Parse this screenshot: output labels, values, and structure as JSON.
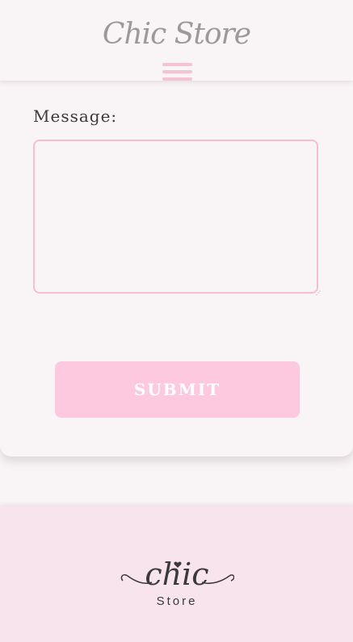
{
  "header": {
    "brand": "Chic Store",
    "menu_icon": "hamburger-menu-icon"
  },
  "form": {
    "message_label": "Message:",
    "message_value": "",
    "submit_label": "SUBMIT"
  },
  "footer": {
    "logo_word": "chic",
    "logo_sub": "Store"
  },
  "colors": {
    "background": "#f9f4f5",
    "accent_pink": "#f6c2d6",
    "button_pink": "#fcc9de",
    "footer_pink": "#f8e4ec",
    "text_dark": "#3a3a3a",
    "brand_gray": "#9a9a9a"
  }
}
